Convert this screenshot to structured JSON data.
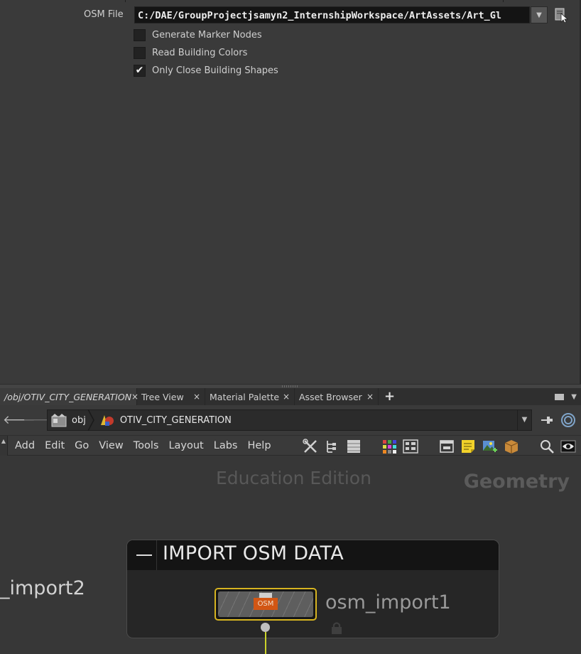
{
  "parameters": {
    "osm_file": {
      "label": "OSM File",
      "value": "C:/DAE/GroupProjectjsamyn2_InternshipWorkspace/ArtAssets/Art_Gl"
    },
    "checkboxes": [
      {
        "label": "Generate Marker Nodes",
        "checked": false,
        "mark": ""
      },
      {
        "label": "Read Building Colors",
        "checked": false,
        "mark": ""
      },
      {
        "label": "Only Close Building Shapes",
        "checked": true,
        "mark": "✔"
      }
    ]
  },
  "tabs": [
    {
      "label": "/obj/OTIV_CITY_GENERATION",
      "active": true,
      "close": "×"
    },
    {
      "label": "Tree View",
      "active": false,
      "close": "×"
    },
    {
      "label": "Material Palette",
      "active": false,
      "close": "×"
    },
    {
      "label": "Asset Browser",
      "active": false,
      "close": "×"
    }
  ],
  "tab_add": "+",
  "path": {
    "crumbs": [
      {
        "label": "obj",
        "icon": "obj-icon"
      },
      {
        "label": "OTIV_CITY_GENERATION",
        "icon": "geometry-network-icon"
      }
    ]
  },
  "menu": {
    "items": [
      "Add",
      "Edit",
      "Go",
      "View",
      "Tools",
      "Layout",
      "Labs",
      "Help"
    ]
  },
  "network": {
    "watermark": "Education Edition",
    "context": "Geometry",
    "offscreen_node": "_import2",
    "netbox": {
      "collapse_icon": "collapse-icon",
      "title": "IMPORT OSM DATA"
    },
    "node": {
      "badge": "OSM",
      "name": "osm_import1"
    }
  },
  "colors": {
    "node_selected_border": "#d7b421",
    "node_badge": "#d25614",
    "wire": "#cbd32a"
  }
}
